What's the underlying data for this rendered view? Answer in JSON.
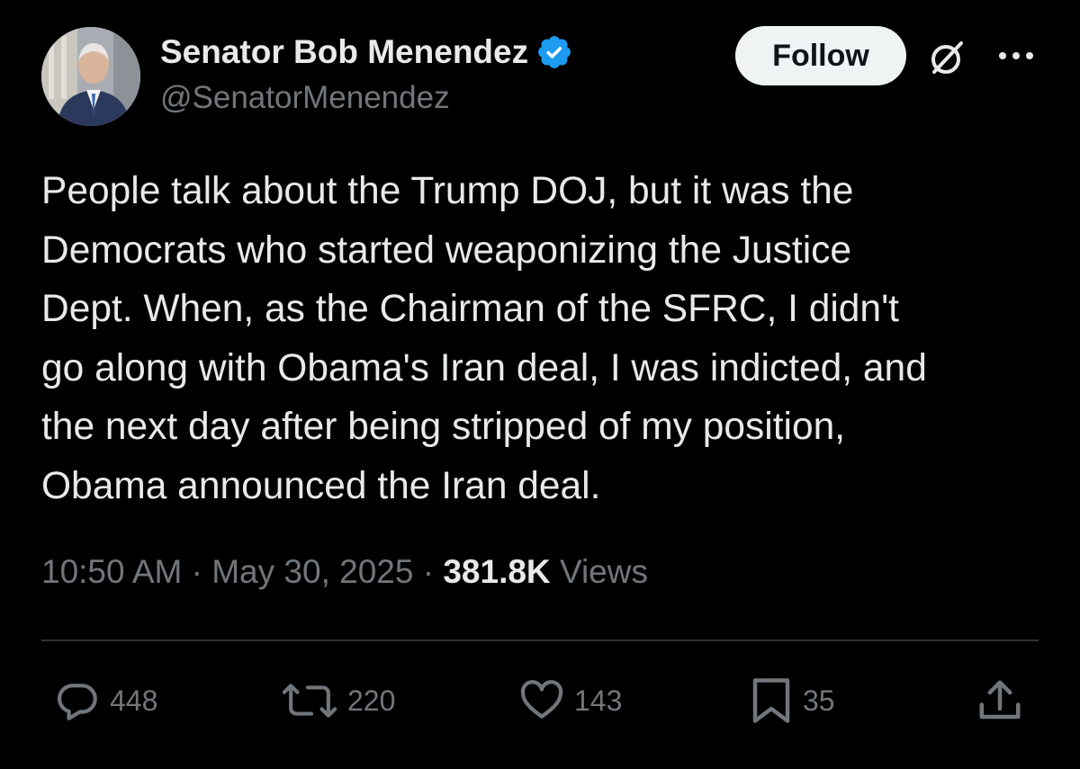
{
  "author": {
    "display_name": "Senator Bob Menendez",
    "handle": "@SenatorMenendez",
    "verified_icon": "verified-badge-icon",
    "avatar_icon": "avatar"
  },
  "header": {
    "follow_label": "Follow",
    "grok_icon": "grok-icon",
    "more_icon": "more-icon"
  },
  "tweet": {
    "text": "People talk about the Trump DOJ, but it was the\nDemocrats who started weaponizing the Justice\nDept. When, as the Chairman of the SFRC, I didn't\ngo along with Obama's Iran deal, I was indicted, and\nthe next day after being stripped of my position,\nObama announced the Iran deal."
  },
  "meta": {
    "time": "10:50 AM",
    "separator": "·",
    "date": "May 30, 2025",
    "views_count": "381.8K",
    "views_label": "Views"
  },
  "actions": {
    "replies": "448",
    "reposts": "220",
    "likes": "143",
    "bookmarks": "35"
  },
  "colors": {
    "background": "#000000",
    "text_primary": "#e7e9ea",
    "text_secondary": "#71767b",
    "divider": "#2f3336",
    "verified_blue": "#1d9bf0",
    "follow_bg": "#eff3f4"
  }
}
